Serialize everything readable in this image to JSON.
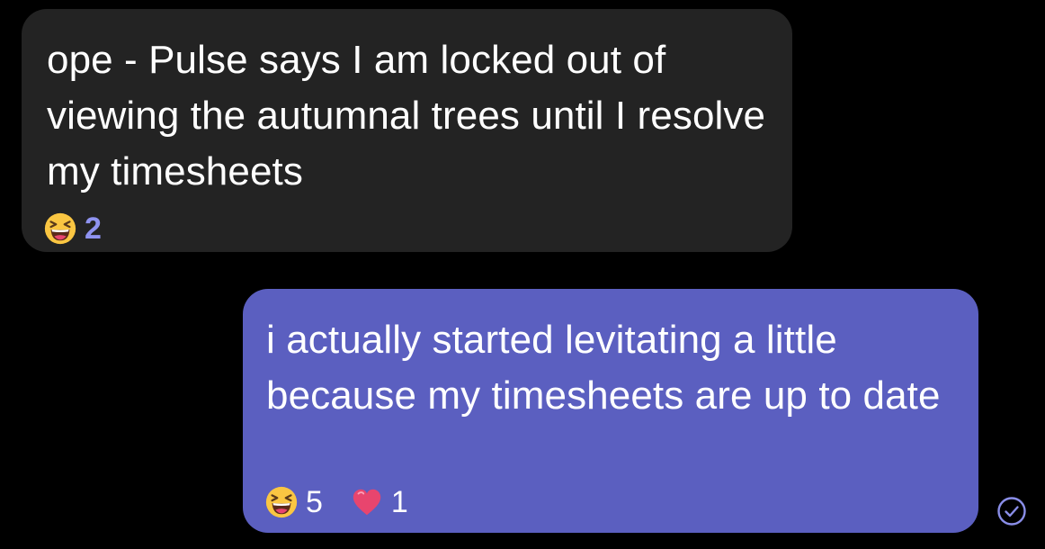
{
  "messages": [
    {
      "direction": "received",
      "text": "ope - Pulse says I am locked out of viewing the autumnal trees until I resolve my timesheets",
      "reactions": [
        {
          "icon": "laughing-squinting-face-icon",
          "count": "2"
        }
      ]
    },
    {
      "direction": "sent",
      "text": "i actually started levitating a little because my timesheets are up to date",
      "reactions": [
        {
          "icon": "laughing-squinting-face-icon",
          "count": "5"
        },
        {
          "icon": "heart-icon",
          "count": "1"
        }
      ],
      "status_icon": "read-receipt-check-icon"
    }
  ],
  "colors": {
    "background": "#000000",
    "received_bubble": "#232323",
    "sent_bubble": "#5b5fc0",
    "received_reaction_count": "#8f93f0",
    "heart": "#e8456e",
    "read_receipt": "#8a8ee8"
  }
}
